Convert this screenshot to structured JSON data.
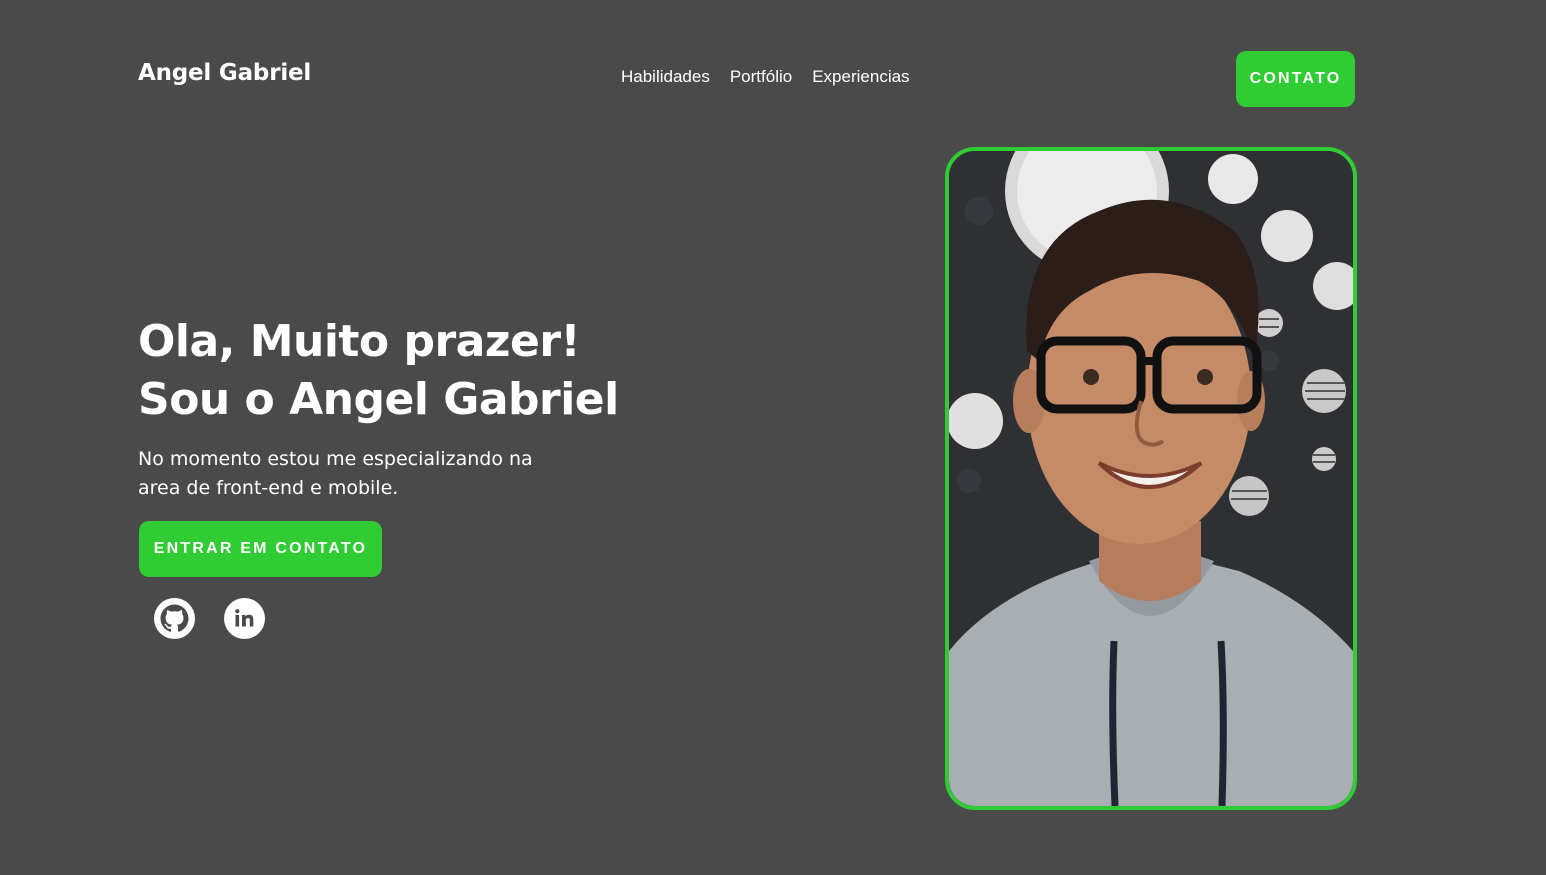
{
  "header": {
    "brand": "Angel Gabriel",
    "nav": [
      "Habilidades",
      "Portfólio",
      "Experiencias"
    ],
    "contact_button": "CONTATO"
  },
  "hero": {
    "title_line1": "Ola, Muito prazer!",
    "title_line2": "Sou o Angel Gabriel",
    "subtitle_line1": "No momento estou me especializando na",
    "subtitle_line2": "area de front-end e mobile.",
    "cta_button": "ENTRAR EM CONTATO",
    "socials": [
      {
        "icon": "github-icon"
      },
      {
        "icon": "linkedin-icon"
      }
    ]
  },
  "photo": {
    "description_icon": "profile-photo"
  },
  "colors": {
    "background": "#4a4a4a",
    "accent": "#2fcc33",
    "text": "#ffffff"
  }
}
